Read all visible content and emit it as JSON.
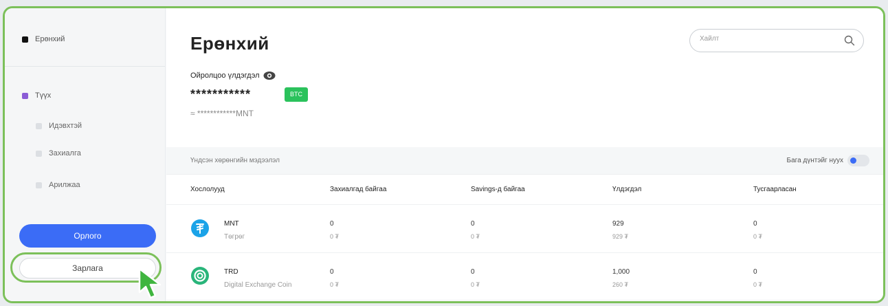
{
  "sidebar": {
    "general": "Ерөнхий",
    "history": "Түүх",
    "active": "Идэвхтэй",
    "orders": "Захиалга",
    "trades": "Арилжаа",
    "income_btn": "Орлого",
    "expense_btn": "Зарлага"
  },
  "header": {
    "title": "Ерөнхий",
    "search_placeholder": "Хайлт"
  },
  "balance": {
    "label": "Ойролцоо үлдэгдэл",
    "masked": "***********",
    "currency_badge": "BTC",
    "mnt_equiv": "≈ ************MNT"
  },
  "assets": {
    "section_title": "Үндсэн хөрөнгийн мэдээлэл",
    "hide_small_label": "Бага дүнтэйг нуух",
    "hide_small_enabled": true,
    "columns": [
      "Хослолууд",
      "Захиалгад байгаа",
      "Savings-д байгаа",
      "Үлдэгдэл",
      "Тусгаарласан"
    ],
    "rows": [
      {
        "symbol": "MNT",
        "name": "Төгрөг",
        "icon": "tugrik-icon",
        "color": "#1ba3e8",
        "in_orders": "0",
        "in_orders_mnt": "0 ₮",
        "in_savings": "0",
        "in_savings_mnt": "0 ₮",
        "balance": "929",
        "balance_mnt": "929 ₮",
        "reserved": "0",
        "reserved_mnt": "0 ₮"
      },
      {
        "symbol": "TRD",
        "name": "Digital Exchange Coin",
        "icon": "trd-coin-icon",
        "color": "#29b57a",
        "in_orders": "0",
        "in_orders_mnt": "0 ₮",
        "in_savings": "0",
        "in_savings_mnt": "0 ₮",
        "balance": "1,000",
        "balance_mnt": "260 ₮",
        "reserved": "0",
        "reserved_mnt": "0 ₮"
      }
    ]
  },
  "colors": {
    "accent": "#3b6cf6",
    "highlight": "#7cc05a",
    "btc_badge": "#2bc25c"
  }
}
